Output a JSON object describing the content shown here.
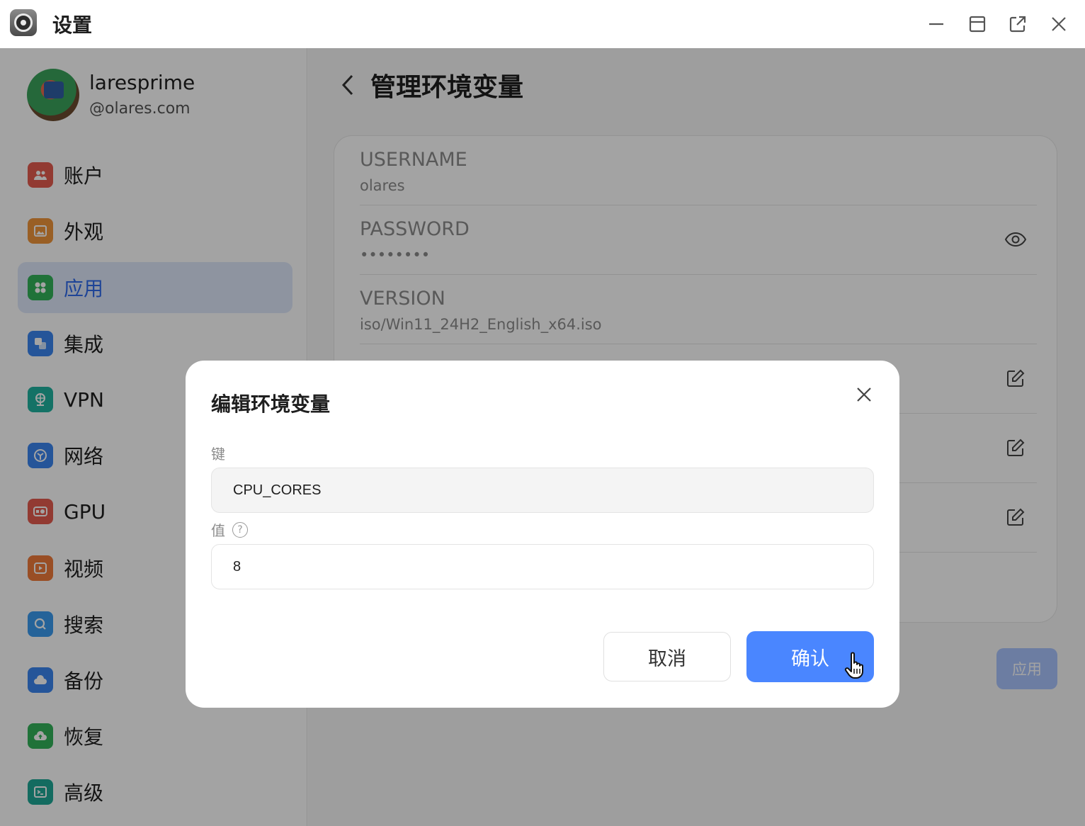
{
  "window": {
    "title": "设置",
    "controls": [
      "minimize-icon",
      "maximize-icon",
      "popout-icon",
      "close-icon"
    ]
  },
  "user": {
    "name": "laresprime",
    "domain": "@olares.com"
  },
  "sidebar": {
    "items": [
      {
        "label": "账户",
        "icon": "account-icon",
        "color": "#e45b4f"
      },
      {
        "label": "外观",
        "icon": "appearance-icon",
        "color": "#f0953a"
      },
      {
        "label": "应用",
        "icon": "apps-icon",
        "color": "#33b35a",
        "active": true
      },
      {
        "label": "集成",
        "icon": "integration-icon",
        "color": "#3a86f0"
      },
      {
        "label": "VPN",
        "icon": "vpn-icon",
        "color": "#20b3a0"
      },
      {
        "label": "网络",
        "icon": "network-icon",
        "color": "#3a86f0"
      },
      {
        "label": "GPU",
        "icon": "gpu-icon",
        "color": "#e45b4f"
      },
      {
        "label": "视频",
        "icon": "video-icon",
        "color": "#f07a3a"
      },
      {
        "label": "搜索",
        "icon": "search-icon",
        "color": "#3a9bf0"
      },
      {
        "label": "备份",
        "icon": "backup-icon",
        "color": "#3a86f0"
      },
      {
        "label": "恢复",
        "icon": "restore-icon",
        "color": "#33b35a"
      },
      {
        "label": "高级",
        "icon": "advanced-icon",
        "color": "#1ea896"
      }
    ]
  },
  "main": {
    "title": "管理环境变量",
    "env_vars": [
      {
        "key": "USERNAME",
        "value": "olares",
        "action": null
      },
      {
        "key": "PASSWORD",
        "value": "••••••••",
        "action": "eye-icon"
      },
      {
        "key": "VERSION",
        "value": "iso/Win11_24H2_English_x64.iso",
        "action": null
      },
      {
        "key": "",
        "value": "",
        "action": "edit-icon"
      },
      {
        "key": "",
        "value": "",
        "action": "edit-icon"
      },
      {
        "key": "",
        "value": "",
        "action": "edit-icon"
      }
    ],
    "apply_label": "应用"
  },
  "dialog": {
    "title": "编辑环境变量",
    "key_label": "键",
    "key_value": "CPU_CORES",
    "value_label": "值",
    "value_value": "8",
    "cancel_label": "取消",
    "confirm_label": "确认"
  },
  "colors": {
    "accent": "#4a86ff",
    "active_nav_bg": "#dfe8fb",
    "apply_disabled": "#a9c4fd"
  }
}
